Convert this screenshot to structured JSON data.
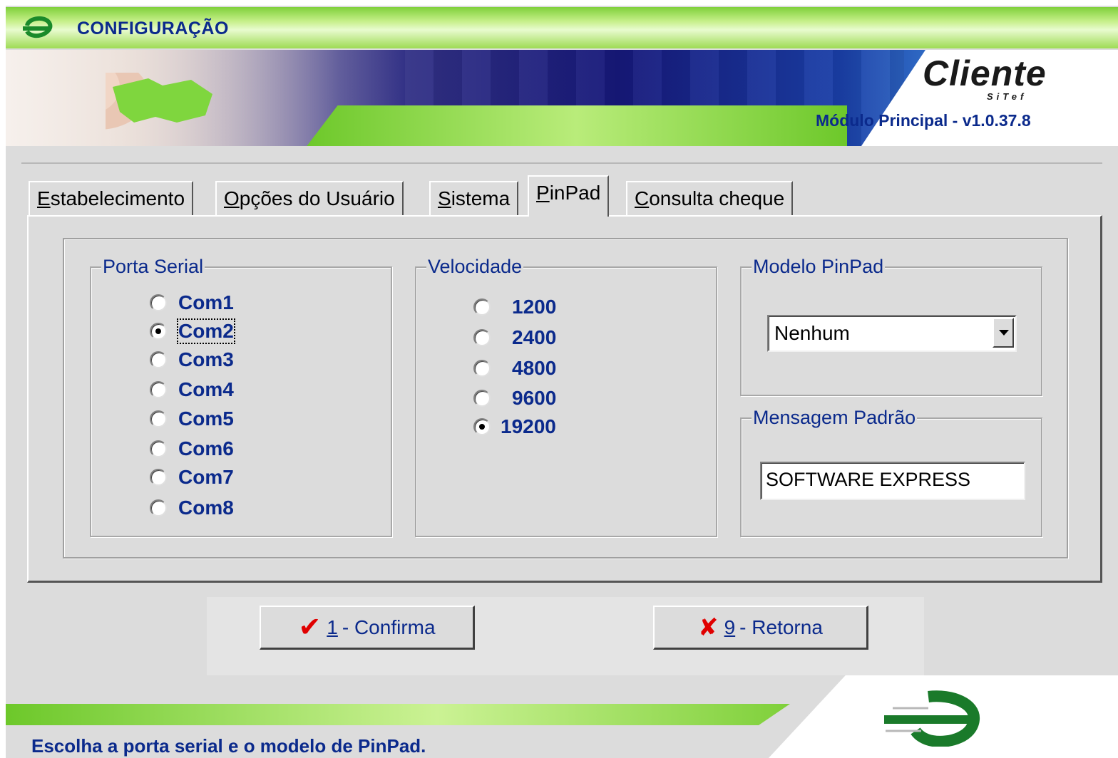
{
  "window": {
    "title": "CONFIGURAÇÃO"
  },
  "banner": {
    "brand": "Cliente",
    "brand_sub": "SiTef",
    "version": "Módulo Principal - v1.0.37.8"
  },
  "tabs": [
    {
      "label_first": "E",
      "label_rest": "stabelecimento",
      "active": false
    },
    {
      "label_first": "O",
      "label_rest": "pções do Usuário",
      "active": false
    },
    {
      "label_first": "S",
      "label_rest": "istema",
      "active": false
    },
    {
      "label_first": "P",
      "label_rest": "inPad",
      "active": true
    },
    {
      "label_first": "C",
      "label_rest": "onsulta cheque",
      "active": false
    }
  ],
  "porta_serial": {
    "label": "Porta Serial",
    "options": [
      "Com1",
      "Com2",
      "Com3",
      "Com4",
      "Com5",
      "Com6",
      "Com7",
      "Com8"
    ],
    "selected": "Com2"
  },
  "velocidade": {
    "label": "Velocidade",
    "options": [
      "1200",
      "2400",
      "4800",
      "9600",
      "19200"
    ],
    "selected": "19200"
  },
  "modelo_pinpad": {
    "label": "Modelo PinPad",
    "value": "Nenhum"
  },
  "mensagem_padrao": {
    "label": "Mensagem Padrão",
    "value": "SOFTWARE EXPRESS"
  },
  "buttons": {
    "confirm_num": "1",
    "confirm_text": "- Confirma",
    "return_num": "9",
    "return_text": "- Retorna"
  },
  "status": "Escolha a porta serial e o modelo de PinPad.",
  "colors": {
    "label_blue": "#0b2a8c",
    "accent_green": "#6dc82a",
    "icon_red": "#e00000"
  }
}
